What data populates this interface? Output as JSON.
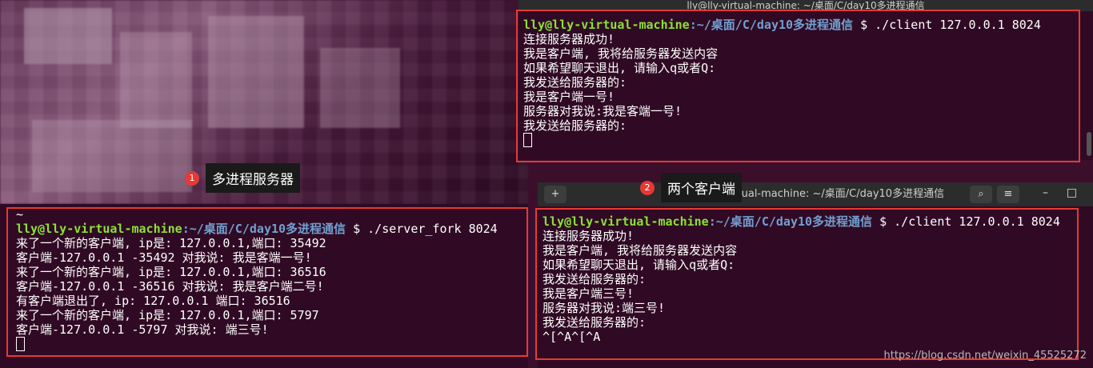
{
  "server": {
    "prompt_user": "lly@lly-virtual-machine",
    "prompt_path": ":~/桌面/C/day10多进程通信",
    "command": "$ ./server_fork 8024",
    "tilde": "~",
    "output": [
      "来了一个新的客户端, ip是: 127.0.0.1,端口: 35492",
      "客户端-127.0.0.1 -35492 对我说: 我是客端一号!",
      "来了一个新的客户端, ip是: 127.0.0.1,端口: 36516",
      "客户端-127.0.0.1 -36516 对我说: 我是客户端二号!",
      "有客户端退出了, ip: 127.0.0.1 端口: 36516",
      "来了一个新的客户端, ip是: 127.0.0.1,端口: 5797",
      "客户端-127.0.0.1 -5797 对我说: 端三号!"
    ]
  },
  "client1": {
    "title": "lly@lly-virtual-machine: ~/桌面/C/day10多进程通信",
    "prompt_user": "lly@lly-virtual-machine",
    "prompt_path": ":~/桌面/C/day10多进程通信",
    "command": "$ ./client 127.0.0.1 8024",
    "output": [
      "连接服务器成功!",
      "我是客户端, 我将给服务器发送内容",
      "如果希望聊天退出, 请输入q或者Q:",
      "我发送给服务器的:",
      "我是客户端一号!",
      "服务器对我说:我是客端一号!",
      "我发送给服务器的:"
    ]
  },
  "client2": {
    "title": "lly@lly-virtual-machine: ~/桌面/C/day10多进程通信",
    "prompt_user": "lly@lly-virtual-machine",
    "prompt_path": ":~/桌面/C/day10多进程通信",
    "command": "$ ./client 127.0.0.1 8024",
    "output": [
      "连接服务器成功!",
      "我是客户端, 我将给服务器发送内容",
      "如果希望聊天退出, 请输入q或者Q:",
      "我发送给服务器的:",
      "我是客户端三号!",
      "服务器对我说:端三号!",
      "我发送给服务器的:",
      "^[^A^[^A"
    ],
    "new_tab_glyph": "+",
    "search_glyph": "⌕",
    "menu_glyph": "≡",
    "minimize_glyph": "–",
    "maximize_glyph": "□"
  },
  "annotations": {
    "badge1_num": "1",
    "badge1_label": "多进程服务器",
    "badge2_num": "2",
    "badge2_label": "两个客户端"
  },
  "watermark": "https://blog.csdn.net/weixin_45525272",
  "colors": {
    "terminal_bg": "#300a24",
    "prompt_user": "#8ae234",
    "prompt_path": "#729fcf",
    "highlight_box": "#e53935"
  }
}
